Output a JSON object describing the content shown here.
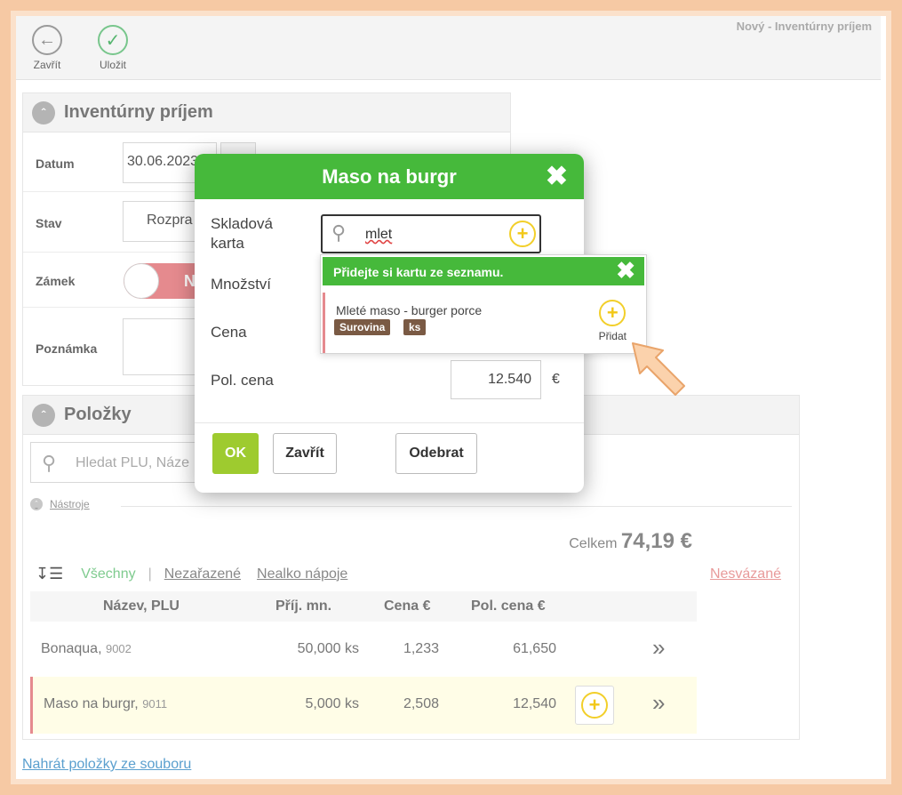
{
  "window": {
    "title": "Nový - Inventúrny príjem"
  },
  "toolbar": {
    "close_label": "Zavřít",
    "save_label": "Uložit"
  },
  "receipt_panel": {
    "title": "Inventúrny príjem",
    "date_label": "Datum",
    "date_value": "30.06.2023",
    "status_label": "Stav",
    "status_value": "Rozpra",
    "lock_label": "Zámek",
    "lock_toggle_text": "N",
    "note_label": "Poznámka"
  },
  "items_panel": {
    "title": "Položky",
    "search_placeholder": "Hledat PLU, Náze",
    "tools_label": "Nástroje",
    "total_label": "Celkem",
    "total_value": "74,19 €",
    "filters": {
      "all": "Všechny",
      "separator": "|",
      "uncategorized": "Nezařazené",
      "soft_drinks": "Nealko nápoje",
      "unbound": "Nesvázané"
    },
    "columns": [
      "Název, PLU",
      "Příj. mn.",
      "Cena €",
      "Pol. cena €"
    ],
    "rows": [
      {
        "name": "Bonaqua,",
        "plu": "9002",
        "qty": "50,000 ks",
        "price": "1,233",
        "total": "61,650",
        "arrow": "»"
      },
      {
        "name": "Maso na burgr,",
        "plu": "9011",
        "qty": "5,000 ks",
        "price": "2,508",
        "total": "12,540",
        "arrow": "»"
      }
    ]
  },
  "bottom_link": "Nahrát položky ze souboru",
  "modal": {
    "title": "Maso na burgr",
    "stock_card_label_line1": "Skladová",
    "stock_card_label_line2": "karta",
    "search_value": "mlet",
    "quantity_label": "Množství",
    "price_label": "Cena",
    "item_price_label": "Pol. cena",
    "item_price_value": "12.540",
    "currency": "€",
    "ok_label": "OK",
    "close_label": "Zavřít",
    "remove_label": "Odebrat"
  },
  "dropdown": {
    "header": "Přidejte si kartu ze seznamu.",
    "item_name": "Mleté maso - burger porce",
    "tag_type": "Surovina",
    "tag_unit": "ks",
    "add_label": "Přidat"
  },
  "colors": {
    "green": "#46b93b",
    "ok_green": "#9ecb2f",
    "yellow_plus": "#f2cf2a",
    "pink": "#e58a8e",
    "tag_brown": "#7a5a44"
  }
}
